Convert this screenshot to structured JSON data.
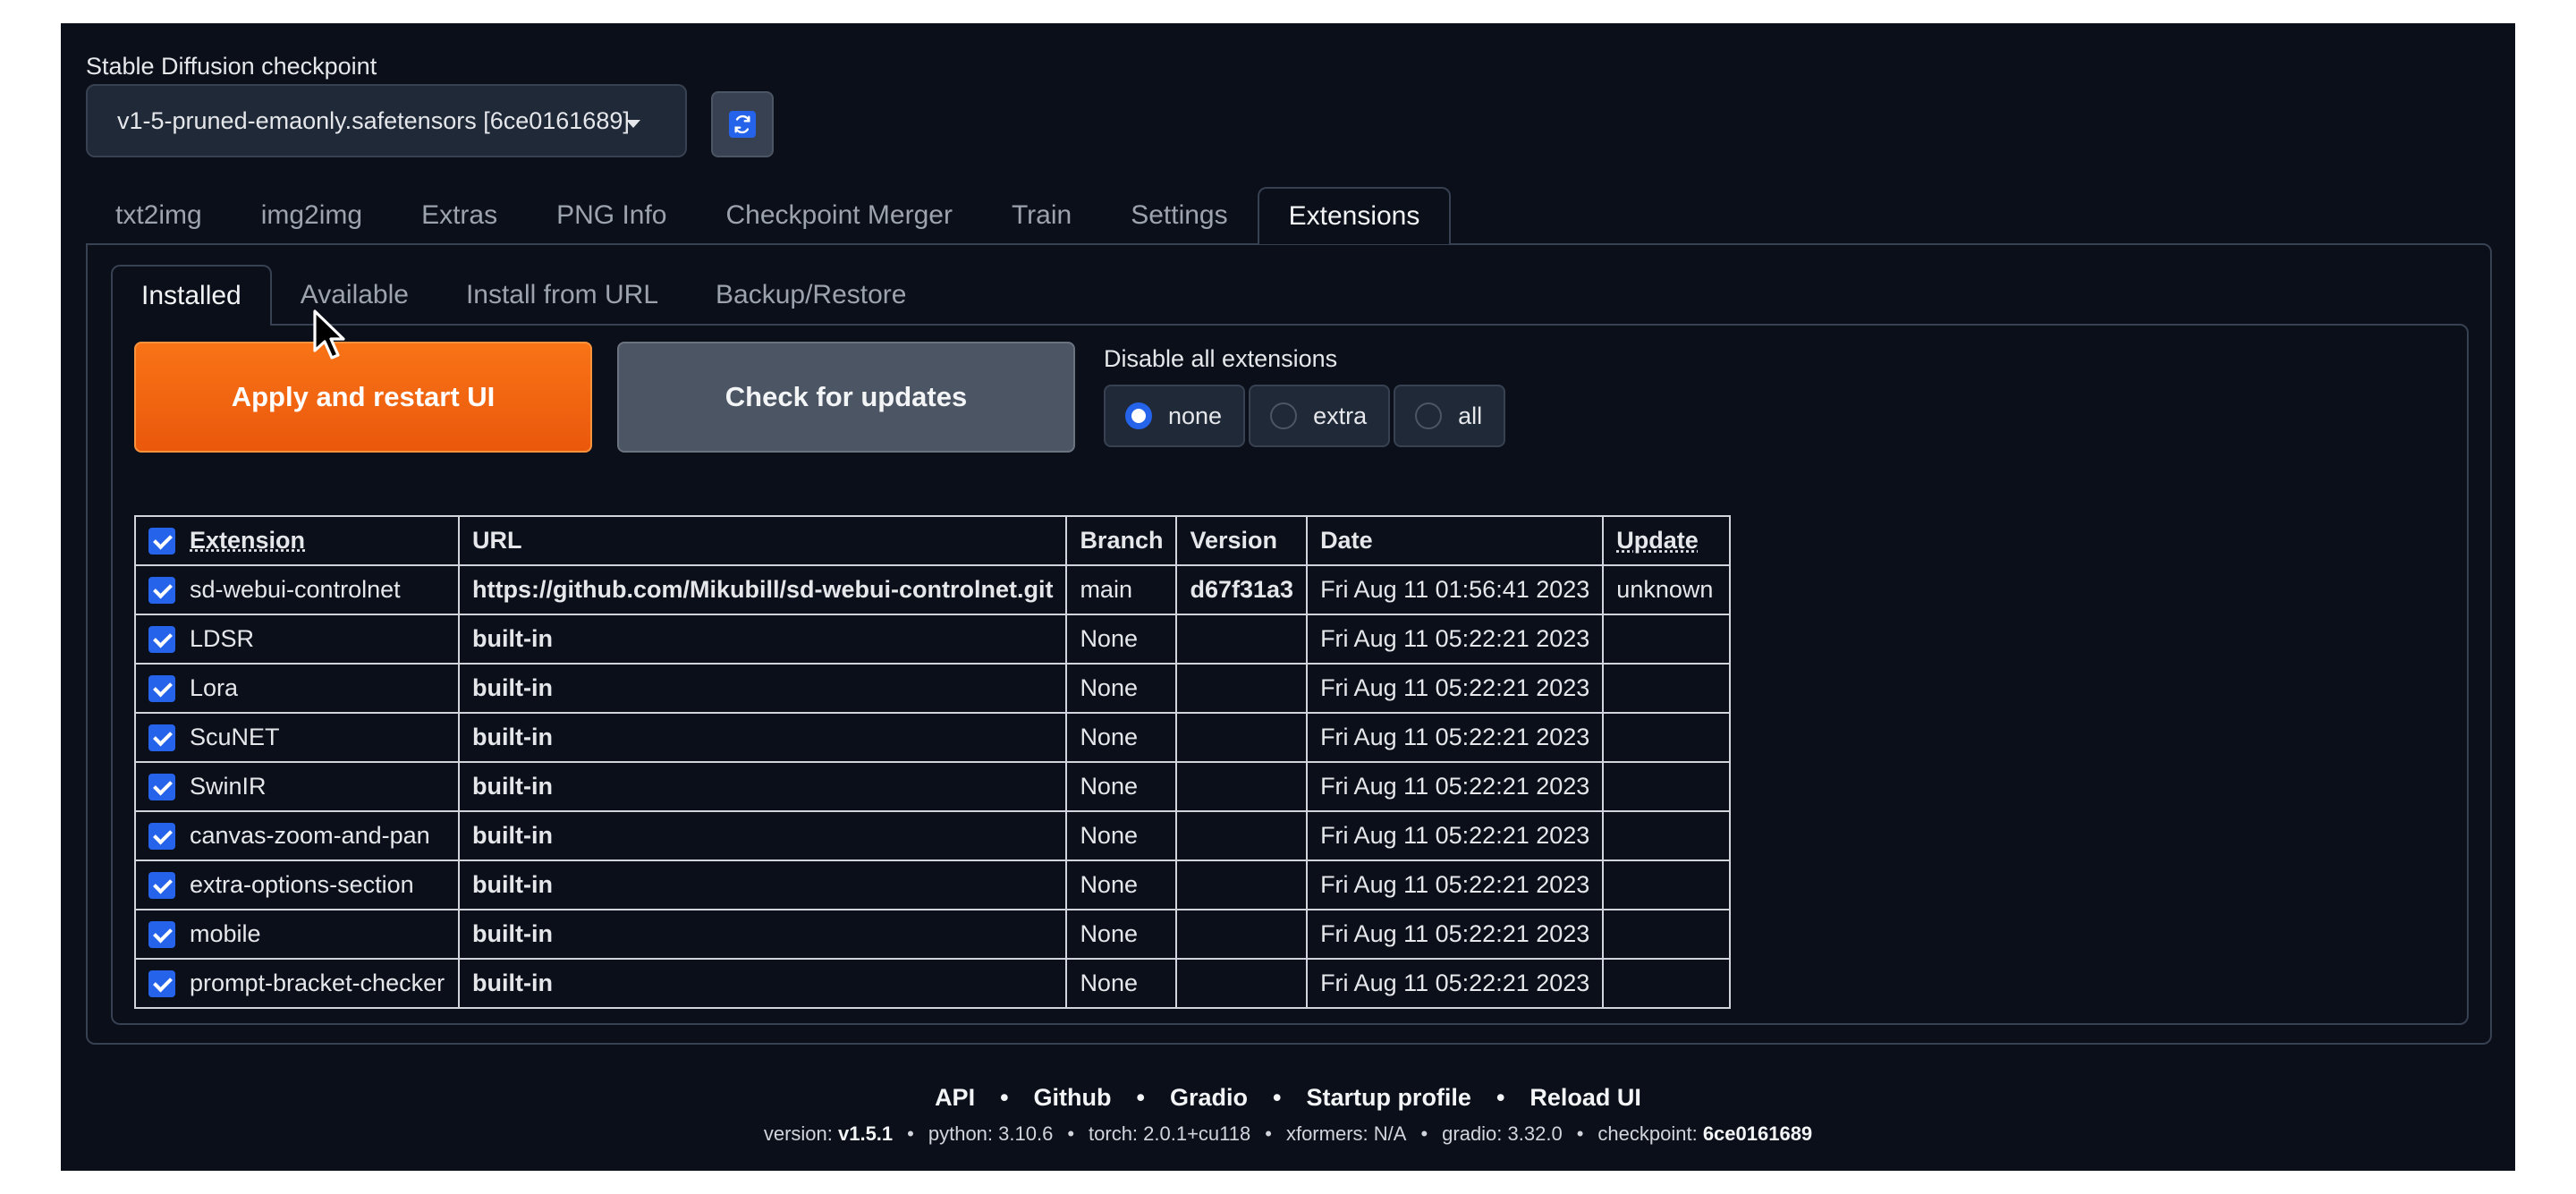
{
  "checkpoint": {
    "label": "Stable Diffusion checkpoint",
    "value": "v1-5-pruned-emaonly.safetensors [6ce0161689]"
  },
  "main_tabs": [
    "txt2img",
    "img2img",
    "Extras",
    "PNG Info",
    "Checkpoint Merger",
    "Train",
    "Settings",
    "Extensions"
  ],
  "sub_tabs": [
    "Installed",
    "Available",
    "Install from URL",
    "Backup/Restore"
  ],
  "buttons": {
    "apply": "Apply and restart UI",
    "check": "Check for updates"
  },
  "disable": {
    "label": "Disable all extensions",
    "options": [
      "none",
      "extra",
      "all"
    ],
    "selected": "none"
  },
  "table": {
    "headers": [
      "Extension",
      "URL",
      "Branch",
      "Version",
      "Date",
      "Update"
    ],
    "rows": [
      [
        "sd-webui-controlnet",
        "https://github.com/Mikubill/sd-webui-controlnet.git",
        "main",
        "d67f31a3",
        "Fri Aug 11 01:56:41 2023",
        "unknown"
      ],
      [
        "LDSR",
        "built-in",
        "None",
        "",
        "Fri Aug 11 05:22:21 2023",
        ""
      ],
      [
        "Lora",
        "built-in",
        "None",
        "",
        "Fri Aug 11 05:22:21 2023",
        ""
      ],
      [
        "ScuNET",
        "built-in",
        "None",
        "",
        "Fri Aug 11 05:22:21 2023",
        ""
      ],
      [
        "SwinIR",
        "built-in",
        "None",
        "",
        "Fri Aug 11 05:22:21 2023",
        ""
      ],
      [
        "canvas-zoom-and-pan",
        "built-in",
        "None",
        "",
        "Fri Aug 11 05:22:21 2023",
        ""
      ],
      [
        "extra-options-section",
        "built-in",
        "None",
        "",
        "Fri Aug 11 05:22:21 2023",
        ""
      ],
      [
        "mobile",
        "built-in",
        "None",
        "",
        "Fri Aug 11 05:22:21 2023",
        ""
      ],
      [
        "prompt-bracket-checker",
        "built-in",
        "None",
        "",
        "Fri Aug 11 05:22:21 2023",
        ""
      ]
    ]
  },
  "footer": {
    "links": [
      "API",
      "Github",
      "Gradio",
      "Startup profile",
      "Reload UI"
    ],
    "versions": [
      {
        "label": "version: ",
        "value": "v1.5.1",
        "bold": true
      },
      {
        "label": "python: ",
        "value": "3.10.6",
        "bold": false
      },
      {
        "label": "torch: ",
        "value": "2.0.1+cu118",
        "bold": false
      },
      {
        "label": "xformers: ",
        "value": "N/A",
        "bold": false
      },
      {
        "label": "gradio: ",
        "value": "3.32.0",
        "bold": false
      },
      {
        "label": "checkpoint: ",
        "value": "6ce0161689",
        "bold": true
      }
    ]
  },
  "colors": {
    "background": "#0b0f19",
    "accent_orange": "#f97316",
    "checkbox_blue": "#2563eb",
    "border": "#374151"
  },
  "icons": {
    "refresh": "refresh-icon",
    "dropdown": "chevron-down-icon",
    "cursor": "mouse-pointer-icon"
  }
}
